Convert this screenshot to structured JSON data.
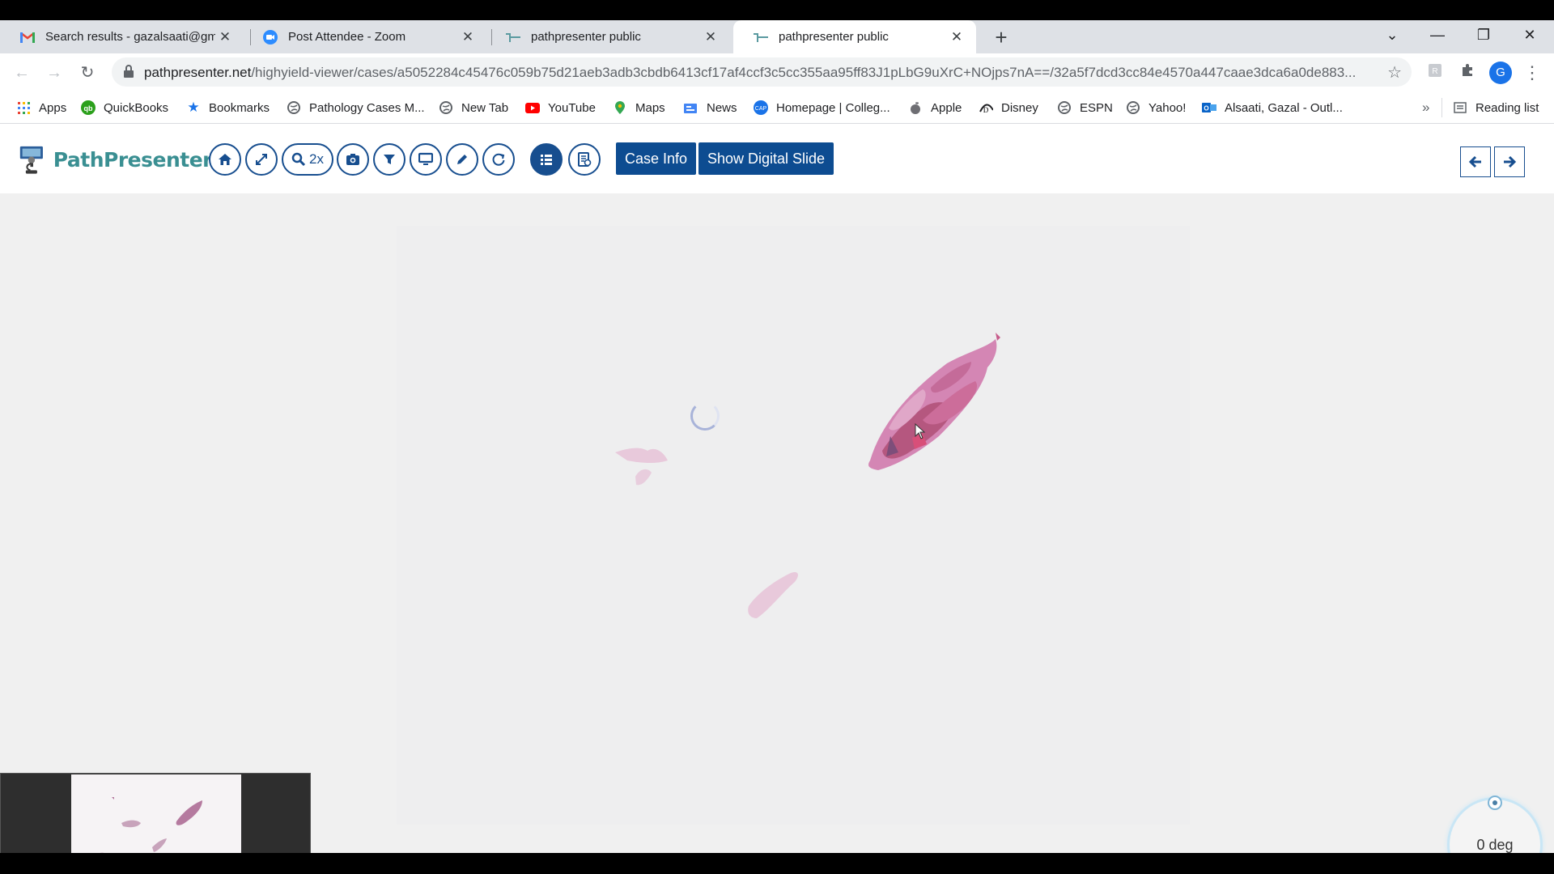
{
  "browser": {
    "tabs": [
      {
        "title": "Search results - gazalsaati@gmail.com",
        "icon": "gmail-icon"
      },
      {
        "title": "Post Attendee - Zoom",
        "icon": "zoom-icon"
      },
      {
        "title": "pathpresenter public",
        "icon": "pathpresenter-icon"
      },
      {
        "title": "pathpresenter public",
        "icon": "pathpresenter-icon",
        "active": true
      }
    ],
    "url_host": "pathpresenter.net",
    "url_path": "/highyield-viewer/cases/a5052284c45476c059b75d21aeb3adb3cbdb6413cf17af4ccf3c5cc355aa95ff83J1pLbG9uXrC+NOjps7nA==/32a5f7dcd3cc84e4570a447caae3dca6a0de883...",
    "profile_initial": "G",
    "bookmarks": [
      {
        "label": "Apps",
        "icon": "apps-grid-icon"
      },
      {
        "label": "QuickBooks",
        "icon": "quickbooks-icon"
      },
      {
        "label": "Bookmarks",
        "icon": "star-icon"
      },
      {
        "label": "Pathology Cases M...",
        "icon": "globe-icon"
      },
      {
        "label": "New Tab",
        "icon": "globe-icon"
      },
      {
        "label": "YouTube",
        "icon": "youtube-icon"
      },
      {
        "label": "Maps",
        "icon": "maps-icon"
      },
      {
        "label": "News",
        "icon": "news-icon"
      },
      {
        "label": "Homepage | Colleg...",
        "icon": "cap-icon"
      },
      {
        "label": "Apple",
        "icon": "apple-icon"
      },
      {
        "label": "Disney",
        "icon": "disney-icon"
      },
      {
        "label": "ESPN",
        "icon": "globe-icon"
      },
      {
        "label": "Yahoo!",
        "icon": "globe-icon"
      },
      {
        "label": "Alsaati, Gazal - Outl...",
        "icon": "outlook-icon"
      }
    ],
    "more_bookmarks": "»",
    "reading_list": "Reading list"
  },
  "app": {
    "logo_text": "PathPresenter",
    "zoom_label": "2x",
    "case_info_label": "Case Info",
    "show_digital_slide_label": "Show Digital Slide",
    "rotation_label": "0 deg",
    "brand_color": "#0d4c91",
    "logo_color": "#3a8f92"
  }
}
